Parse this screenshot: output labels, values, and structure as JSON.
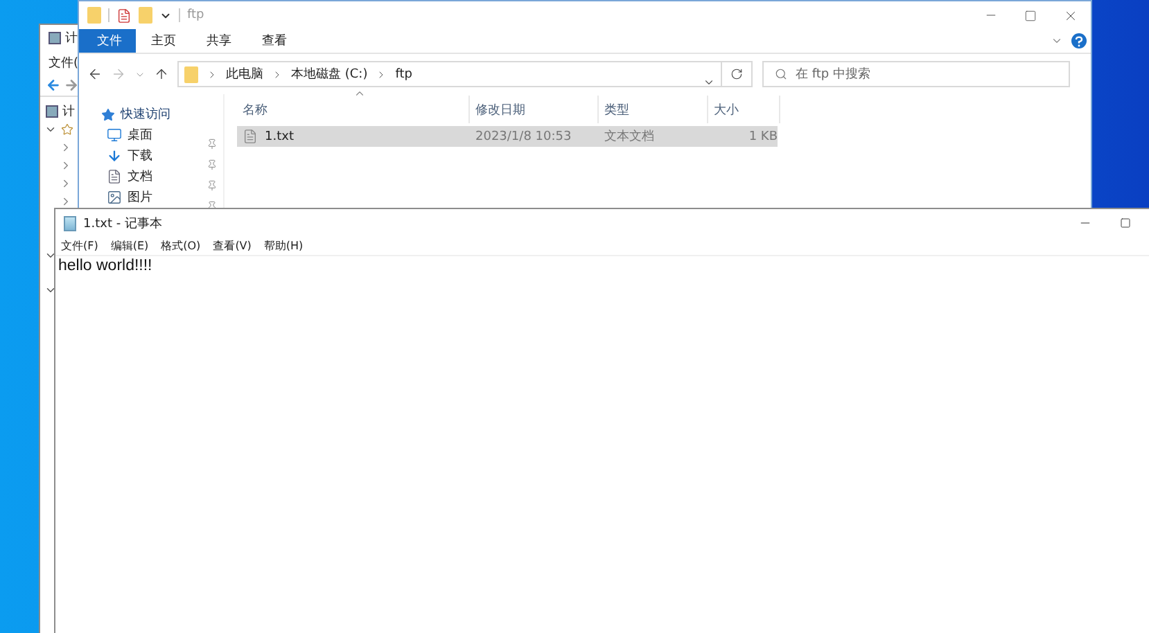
{
  "back_window": {
    "title": "计",
    "menu": [
      "文件("
    ],
    "tree": [
      {
        "label": "计",
        "children": [
          {
            "expanded": true,
            "children": [
              {
                "expanded": false
              },
              {
                "expanded": false
              },
              {
                "expanded": false
              },
              {
                "expanded": false
              }
            ]
          },
          {
            "expanded": true
          },
          {
            "expanded": true
          }
        ]
      }
    ]
  },
  "explorer": {
    "title": "ftp",
    "ribbon_tabs": [
      {
        "label": "文件",
        "selected": true
      },
      {
        "label": "主页",
        "selected": false
      },
      {
        "label": "共享",
        "selected": false
      },
      {
        "label": "查看",
        "selected": false
      }
    ],
    "breadcrumb": [
      "此电脑",
      "本地磁盘 (C:)",
      "ftp"
    ],
    "search": {
      "placeholder": "在 ftp 中搜索"
    },
    "nav_items": [
      {
        "label": "快速访问",
        "kind": "quick_access"
      },
      {
        "label": "桌面",
        "kind": "desktop"
      },
      {
        "label": "下载",
        "kind": "downloads"
      },
      {
        "label": "文档",
        "kind": "documents"
      },
      {
        "label": "图片",
        "kind": "pictures"
      }
    ],
    "columns": [
      {
        "label": "名称",
        "sorted": true
      },
      {
        "label": "修改日期",
        "sorted": false
      },
      {
        "label": "类型",
        "sorted": false
      },
      {
        "label": "大小",
        "sorted": false
      }
    ],
    "rows": [
      {
        "name": "1.txt",
        "modified": "2023/1/8 10:53",
        "type": "文本文档",
        "size": "1 KB",
        "selected": true
      }
    ]
  },
  "notepad": {
    "title": "1.txt - 记事本",
    "menu": [
      "文件(F)",
      "编辑(E)",
      "格式(O)",
      "查看(V)",
      "帮助(H)"
    ],
    "content": "hello world!!!!"
  }
}
